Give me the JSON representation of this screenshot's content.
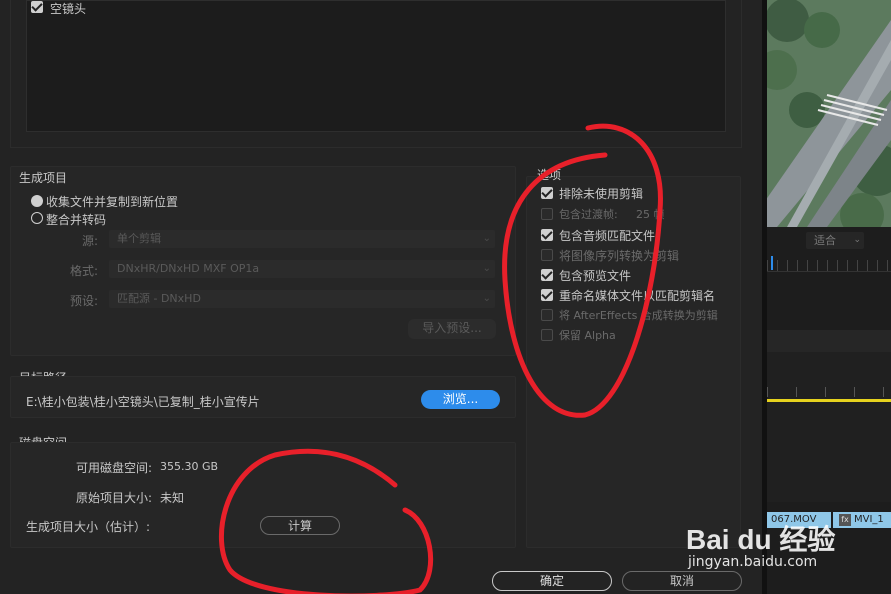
{
  "top_box": {
    "checkbox_label": "空镜头",
    "checked": true
  },
  "generate_project": {
    "title": "生成项目",
    "option_collect": "收集文件并复制到新位置",
    "option_consolidate": "整合并转码",
    "source_label": "源:",
    "source_value": "单个剪辑",
    "format_label": "格式:",
    "format_value": "DNxHR/DNxHD MXF OP1a",
    "preset_label": "预设:",
    "preset_value": "匹配源 - DNxHD",
    "import_preset_button": "导入预设..."
  },
  "options": {
    "title": "选项",
    "items": [
      {
        "label": "排除未使用剪辑",
        "checked": true,
        "enabled": true
      },
      {
        "label": "包含过渡帧:",
        "checked": false,
        "enabled": false,
        "value": "25 帧"
      },
      {
        "label": "包含音频匹配文件",
        "checked": true,
        "enabled": true
      },
      {
        "label": "将图像序列转换为剪辑",
        "checked": false,
        "enabled": false
      },
      {
        "label": "包含预览文件",
        "checked": true,
        "enabled": true
      },
      {
        "label": "重命名媒体文件以匹配剪辑名",
        "checked": true,
        "enabled": true
      },
      {
        "label": "将 AfterEffects 合成转换为剪辑",
        "checked": false,
        "enabled": false
      },
      {
        "label": "保留 Alpha",
        "checked": false,
        "enabled": false
      }
    ]
  },
  "target_path": {
    "title": "目标路径",
    "path": "E:\\桂小包装\\桂小空镜头\\已复制_桂小宣传片",
    "browse_button": "浏览..."
  },
  "disk_space": {
    "title": "磁盘空间",
    "available_label": "可用磁盘空间:",
    "available_value": "355.30 GB",
    "original_label": "原始项目大小:",
    "original_value": "未知",
    "generated_label": "生成项目大小（估计）:",
    "calculate_button": "计算"
  },
  "footer": {
    "ok_button": "确定",
    "cancel_button": "取消"
  },
  "right_panel": {
    "fit_label": "适合",
    "clip1": "067.MOV",
    "clip2": "MVI_1",
    "fx_badge": "fx"
  },
  "watermark": {
    "brand": "Bai du 经验",
    "url": "jingyan.baidu.com"
  },
  "colors": {
    "accent_blue": "#2d8ceb",
    "annotation_red": "#e8202a",
    "timeline_yellow": "#e6d21e"
  }
}
